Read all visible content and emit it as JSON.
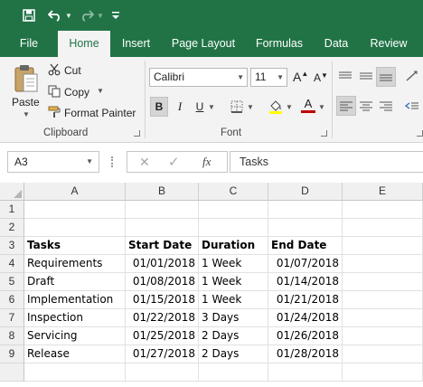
{
  "qat": {
    "icons": [
      "save-icon",
      "undo-icon",
      "redo-icon",
      "customize-qat-icon"
    ]
  },
  "tabs": [
    "File",
    "Home",
    "Insert",
    "Page Layout",
    "Formulas",
    "Data",
    "Review"
  ],
  "active_tab": "Home",
  "clipboard": {
    "paste_label": "Paste",
    "cut_label": "Cut",
    "copy_label": "Copy",
    "format_painter_label": "Format Painter",
    "group_label": "Clipboard"
  },
  "font": {
    "font_name": "Calibri",
    "font_size": "11",
    "bold_label": "B",
    "italic_label": "I",
    "underline_label": "U",
    "grow_label": "A",
    "shrink_label": "A",
    "font_color_label": "A",
    "group_label": "Font",
    "fill_color": "#ffff00",
    "font_color": "#c00000"
  },
  "formula_bar": {
    "name_box": "A3",
    "cancel_icon": "✕",
    "enter_icon": "✓",
    "fx_label": "fx",
    "content": "Tasks"
  },
  "sheet": {
    "columns": [
      "A",
      "B",
      "C",
      "D",
      "E"
    ],
    "rows": [
      "1",
      "2",
      "3",
      "4",
      "5",
      "6",
      "7",
      "8",
      "9",
      ""
    ],
    "header": [
      "Tasks",
      "Start Date",
      "Duration",
      "End Date"
    ],
    "data": [
      [
        "Requirements",
        "01/01/2018",
        "1 Week",
        "01/07/2018"
      ],
      [
        "Draft",
        "01/08/2018",
        "1 Week",
        "01/14/2018"
      ],
      [
        "Implementation",
        "01/15/2018",
        "1 Week",
        "01/21/2018"
      ],
      [
        "Inspection",
        "01/22/2018",
        "3 Days",
        "01/24/2018"
      ],
      [
        "Servicing",
        "01/25/2018",
        "2 Days",
        "01/26/2018"
      ],
      [
        "Release",
        "01/27/2018",
        "2 Days",
        "01/28/2018"
      ]
    ]
  },
  "colors": {
    "accent": "#217346",
    "ribbon_bg": "#f3f3f3"
  }
}
